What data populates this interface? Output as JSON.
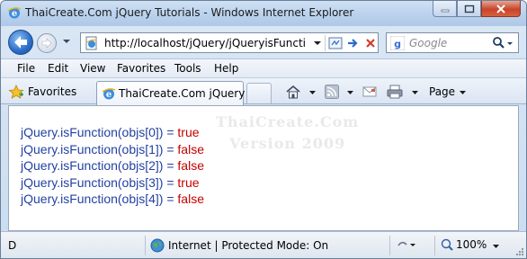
{
  "window": {
    "title": "ThaiCreate.Com jQuery Tutorials - Windows Internet Explorer"
  },
  "address": {
    "url": "http://localhost/jQuery/jQueryisFunctio",
    "search_placeholder": "Google"
  },
  "menu": {
    "items": [
      "File",
      "Edit",
      "View",
      "Favorites",
      "Tools",
      "Help"
    ]
  },
  "favorites_bar": {
    "favorites_label": "Favorites",
    "tab_label": "ThaiCreate.Com jQuery ...",
    "page_label": "Page"
  },
  "content": {
    "watermark_line1": "ThaiCreate.Com",
    "watermark_line2": "Version 2009",
    "lines": [
      {
        "expr": "jQuery.isFunction(objs[0]) = ",
        "value": "true"
      },
      {
        "expr": "jQuery.isFunction(objs[1]) = ",
        "value": "false"
      },
      {
        "expr": "jQuery.isFunction(objs[2]) = ",
        "value": "false"
      },
      {
        "expr": "jQuery.isFunction(objs[3]) = ",
        "value": "true"
      },
      {
        "expr": "jQuery.isFunction(objs[4]) = ",
        "value": "false"
      }
    ]
  },
  "status": {
    "left_text": "D",
    "zone_text": "Internet | Protected Mode: On",
    "zoom": "100%"
  },
  "colors": {
    "expression": "#2341a3",
    "value": "#c40000"
  },
  "icons": {
    "app": "ie-icon",
    "back": "back-arrow-icon",
    "forward": "forward-arrow-icon",
    "home": "home-icon",
    "feeds": "rss-icon",
    "mail": "mail-icon",
    "print": "printer-icon",
    "search": "magnifier-icon",
    "globe": "globe-icon"
  }
}
